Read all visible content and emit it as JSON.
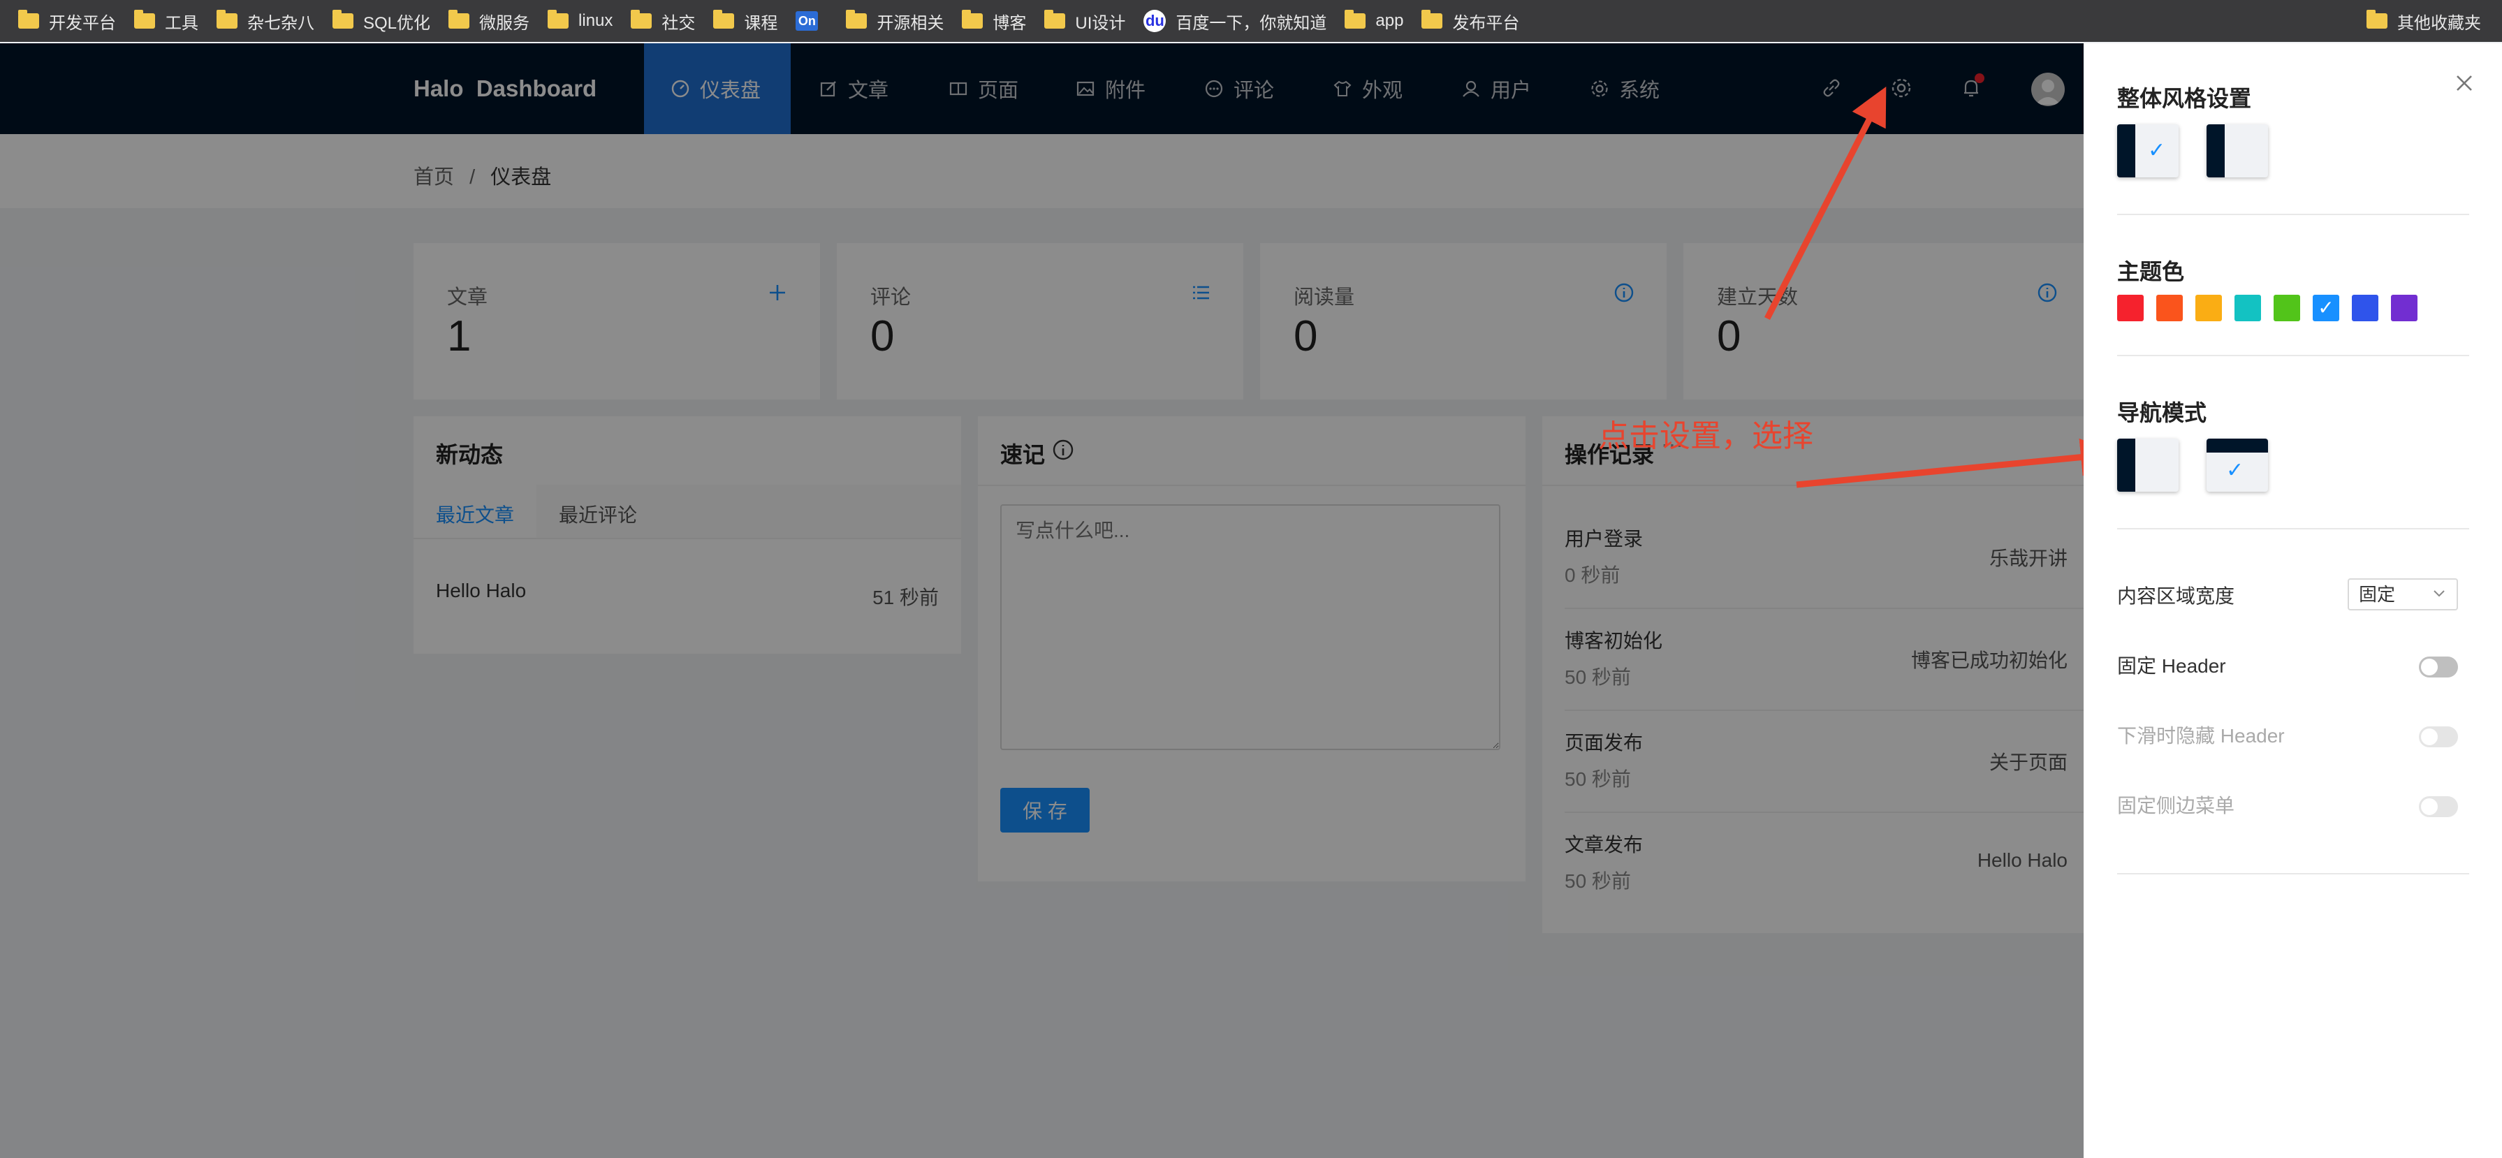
{
  "bookmarks": {
    "items": [
      {
        "label": "开发平台",
        "icon": "folder-icon"
      },
      {
        "label": "工具",
        "icon": "folder-icon"
      },
      {
        "label": "杂七杂八",
        "icon": "folder-icon"
      },
      {
        "label": "SQL优化",
        "icon": "folder-icon"
      },
      {
        "label": "微服务",
        "icon": "folder-icon"
      },
      {
        "label": "linux",
        "icon": "folder-icon"
      },
      {
        "label": "社交",
        "icon": "folder-icon"
      },
      {
        "label": "课程",
        "icon": "folder-icon"
      },
      {
        "label": "",
        "icon": "on-icon",
        "icon_text": "On"
      },
      {
        "label": "开源相关",
        "icon": "folder-icon"
      },
      {
        "label": "博客",
        "icon": "folder-icon"
      },
      {
        "label": "UI设计",
        "icon": "folder-icon"
      },
      {
        "label": "百度一下，你就知道",
        "icon": "baidu-icon",
        "icon_text": "du"
      },
      {
        "label": "app",
        "icon": "folder-icon"
      },
      {
        "label": "发布平台",
        "icon": "folder-icon"
      }
    ],
    "other": "其他收藏夹"
  },
  "header": {
    "logo": "Halo  Dashboard",
    "nav": [
      {
        "label": "仪表盘",
        "icon": "dashboard-icon",
        "active": true
      },
      {
        "label": "文章",
        "icon": "edit-icon",
        "active": false
      },
      {
        "label": "页面",
        "icon": "book-icon",
        "active": false
      },
      {
        "label": "附件",
        "icon": "picture-icon",
        "active": false
      },
      {
        "label": "评论",
        "icon": "comment-icon",
        "active": false
      },
      {
        "label": "外观",
        "icon": "skin-icon",
        "active": false
      },
      {
        "label": "用户",
        "icon": "user-icon",
        "active": false
      },
      {
        "label": "系统",
        "icon": "setting-icon",
        "active": false
      }
    ]
  },
  "breadcrumb": {
    "home": "首页",
    "sep": "/",
    "current": "仪表盘"
  },
  "stats": [
    {
      "label": "文章",
      "value": "1",
      "icon": "plus-icon"
    },
    {
      "label": "评论",
      "value": "0",
      "icon": "list-icon"
    },
    {
      "label": "阅读量",
      "value": "0",
      "icon": "info-icon"
    },
    {
      "label": "建立天数",
      "value": "0",
      "icon": "info-icon"
    }
  ],
  "activity": {
    "title": "新动态",
    "tabs": [
      "最近文章",
      "最近评论"
    ],
    "items": [
      {
        "title": "Hello Halo",
        "time": "51 秒前"
      }
    ]
  },
  "memo": {
    "title": "速记",
    "placeholder": "写点什么吧...",
    "save": "保 存"
  },
  "logs": {
    "title": "操作记录",
    "items": [
      {
        "type": "用户登录",
        "time": "0 秒前",
        "content": "乐哉开讲"
      },
      {
        "type": "博客初始化",
        "time": "50 秒前",
        "content": "博客已成功初始化"
      },
      {
        "type": "页面发布",
        "time": "50 秒前",
        "content": "关于页面"
      },
      {
        "type": "文章发布",
        "time": "50 秒前",
        "content": "Hello Halo"
      }
    ]
  },
  "drawer": {
    "style_title": "整体风格设置",
    "color_title": "主题色",
    "colors": [
      "#f5222d",
      "#fa541c",
      "#faad14",
      "#13c2c2",
      "#52c41a",
      "#1890ff",
      "#2f54eb",
      "#722ed1"
    ],
    "selected_color": 5,
    "nav_title": "导航模式",
    "content_width_label": "内容区域宽度",
    "content_width_value": "固定",
    "fixed_header": "固定 Header",
    "hide_header": "下滑时隐藏 Header",
    "fixed_sidebar": "固定侧边菜单",
    "check": "✓"
  },
  "annotation": {
    "text": "点击设置，选择",
    "color": "#e8442e"
  }
}
